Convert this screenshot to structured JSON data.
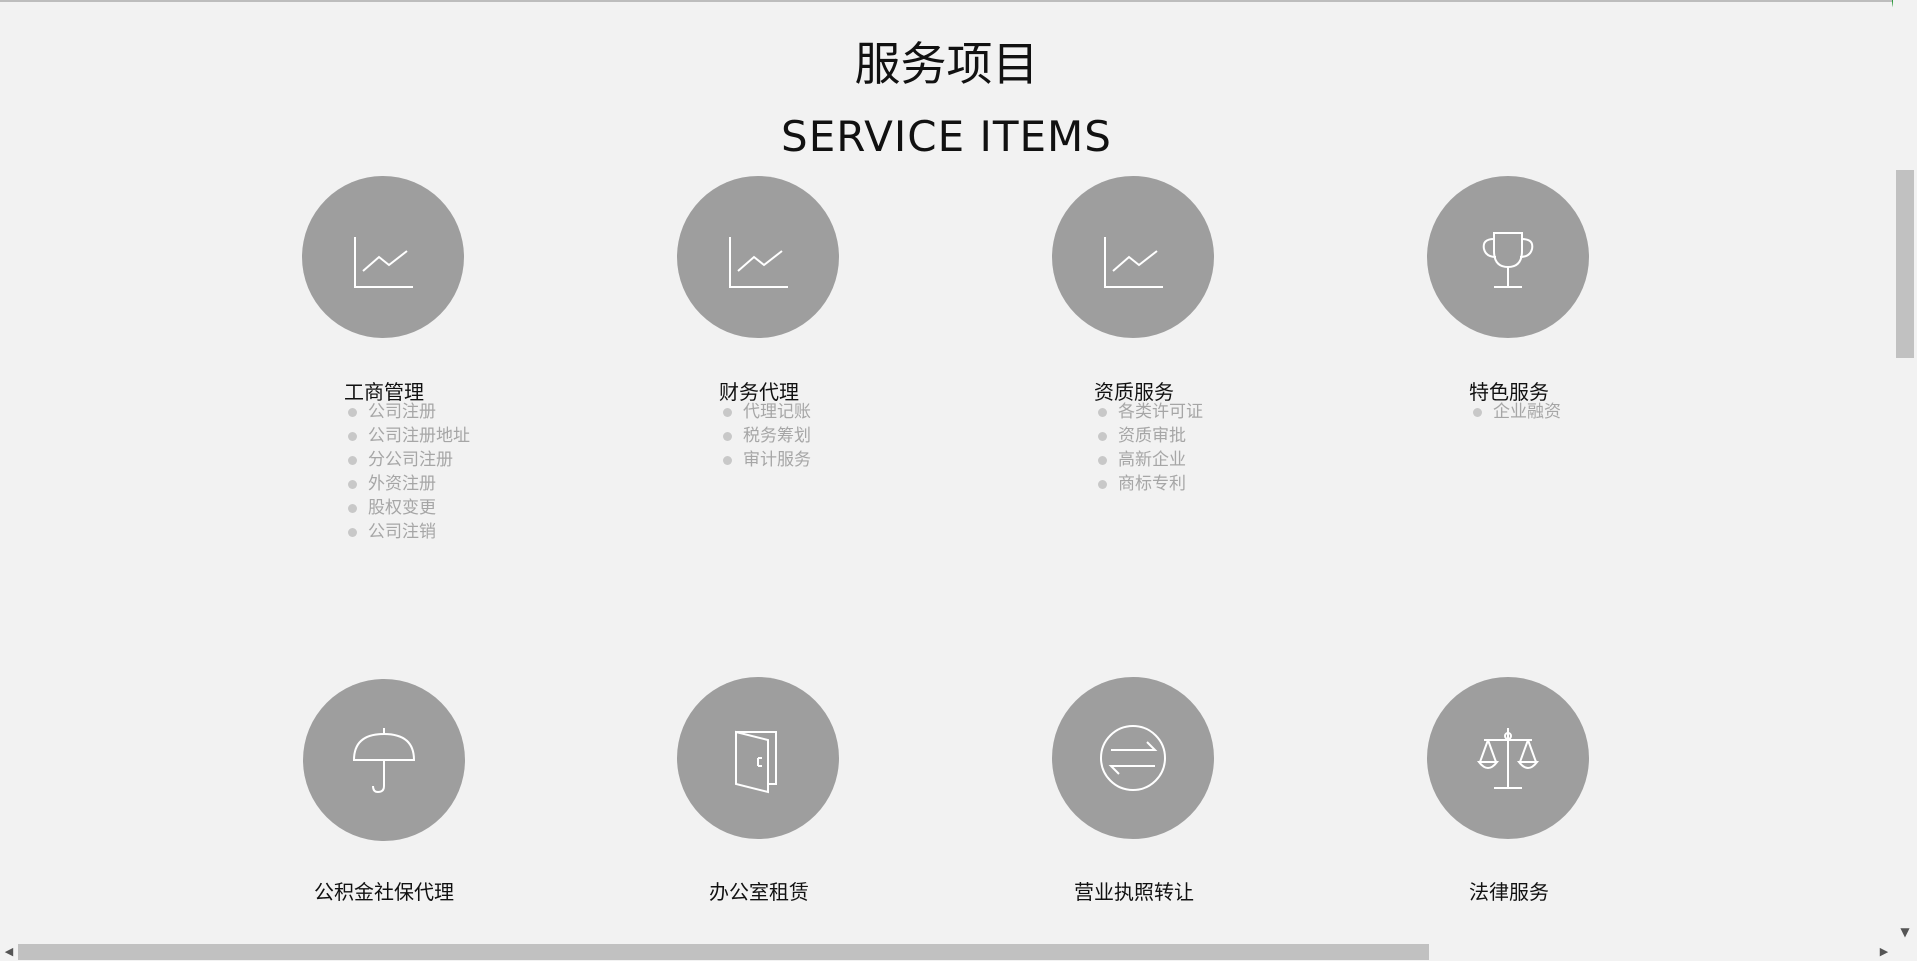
{
  "page": {
    "title_cn": "服务项目",
    "title_en": "SERVICE ITEMS"
  },
  "services": [
    {
      "title": "工商管理",
      "icon": "line-chart-icon",
      "items": [
        "公司注册",
        "公司注册地址",
        "分公司注册",
        "外资注册",
        "股权变更",
        "公司注销"
      ]
    },
    {
      "title": "财务代理",
      "icon": "line-chart-icon",
      "items": [
        "代理记账",
        "税务筹划",
        "审计服务"
      ]
    },
    {
      "title": "资质服务",
      "icon": "line-chart-icon",
      "items": [
        "各类许可证",
        "资质审批",
        "高新企业",
        "商标专利"
      ]
    },
    {
      "title": "特色服务",
      "icon": "trophy-icon",
      "items": [
        "企业融资"
      ]
    },
    {
      "title": "公积金社保代理",
      "icon": "umbrella-icon",
      "items": []
    },
    {
      "title": "办公室租赁",
      "icon": "door-icon",
      "items": []
    },
    {
      "title": "营业执照转让",
      "icon": "exchange-icon",
      "items": []
    },
    {
      "title": "法律服务",
      "icon": "scales-icon",
      "items": []
    }
  ],
  "colors": {
    "background": "#f2f2f2",
    "circle": "#9e9e9e",
    "icon_stroke": "#ffffff",
    "subitem_text": "#a6a6a6"
  }
}
